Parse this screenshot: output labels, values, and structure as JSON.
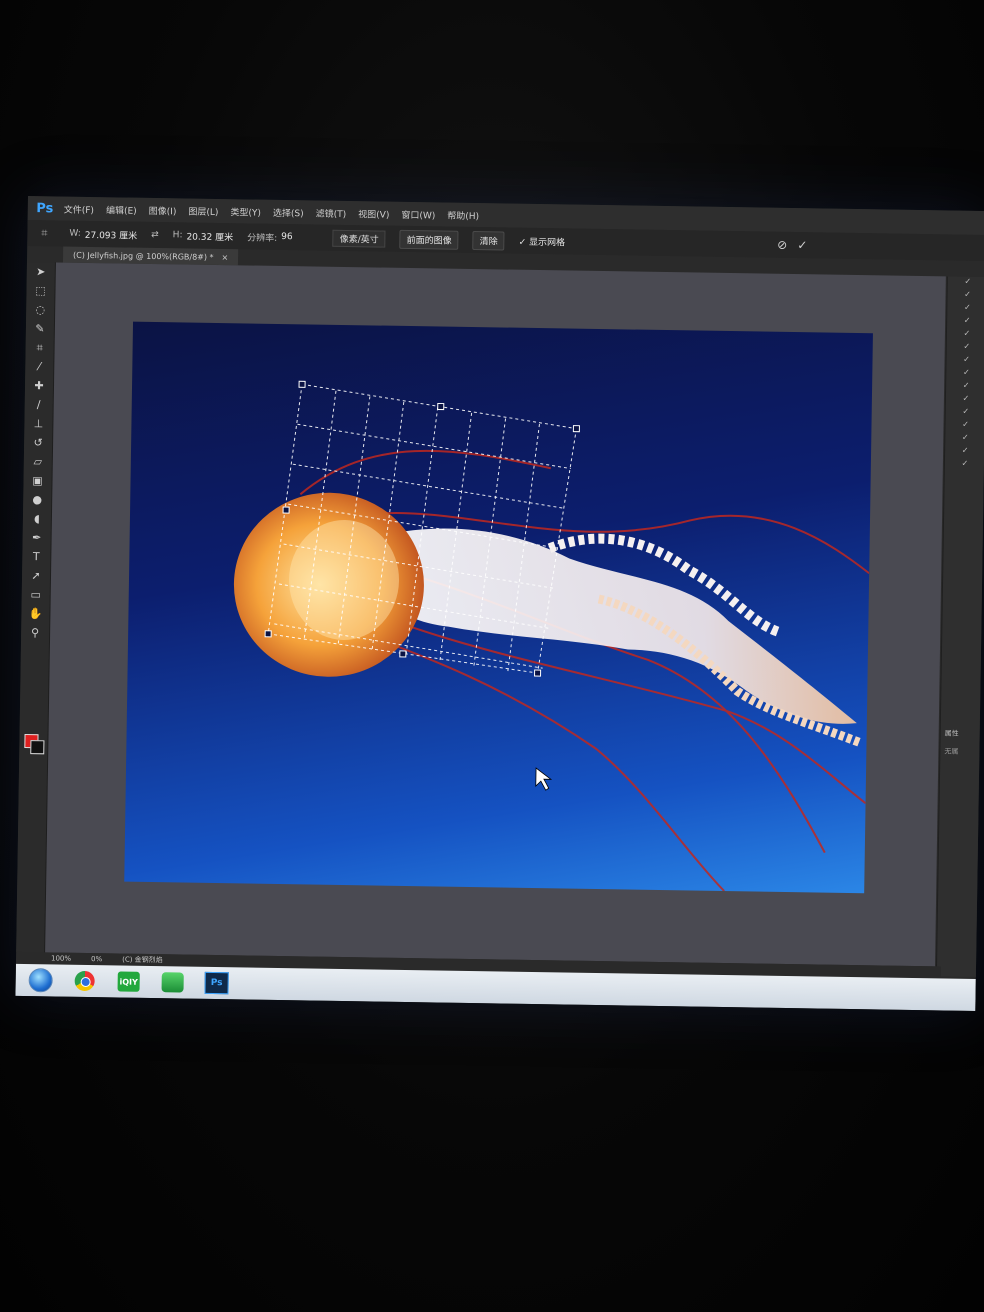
{
  "app": {
    "logo": "Ps",
    "menu": [
      "文件(F)",
      "编辑(E)",
      "图像(I)",
      "图层(L)",
      "类型(Y)",
      "选择(S)",
      "滤镜(T)",
      "视图(V)",
      "窗口(W)",
      "帮助(H)"
    ]
  },
  "options": {
    "width_label": "W:",
    "width_value": "27.093 厘米",
    "height_label": "H:",
    "height_value": "20.32 厘米",
    "resolution_label": "分辨率:",
    "resolution_value": "96",
    "unit_select": "像素/英寸",
    "front_image_button": "前面的图像",
    "clear_button": "清除",
    "show_grid_label": "显示网格",
    "show_grid_checked": true
  },
  "document": {
    "tab_title": "(C) Jellyfish.jpg @ 100%(RGB/8#) *",
    "tab_close": "×"
  },
  "statusbar": {
    "zoom": "100%",
    "zoom_field": "0%",
    "info": "(C) 金钢烈焰"
  },
  "panel": {
    "properties_label": "属性",
    "properties_value": "无属"
  },
  "taskbar": {
    "ps_label": "Ps",
    "iqiyi_label": "iQIY"
  },
  "colors": {
    "foreground": "#e02020",
    "background": "#111111",
    "ps_blue": "#3fa6ff"
  }
}
